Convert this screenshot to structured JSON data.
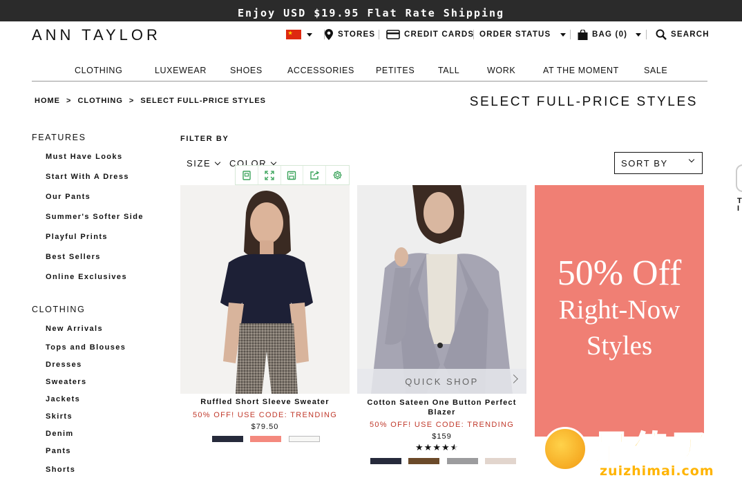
{
  "promo_bar": {
    "text": "Enjoy USD $19.95 Flat Rate Shipping"
  },
  "header": {
    "logo": "ANN TAYLOR",
    "utility": {
      "stores": "STORES",
      "credit_cards": "CREDIT CARDS",
      "order_status": "ORDER STATUS",
      "bag": "BAG (0)",
      "search": "SEARCH"
    }
  },
  "nav": {
    "items": [
      "CLOTHING",
      "LUXEWEAR",
      "SHOES",
      "ACCESSORIES",
      "PETITES",
      "TALL",
      "WORK",
      "AT THE MOMENT",
      "SALE"
    ]
  },
  "breadcrumb": {
    "home": "HOME",
    "sep1": ">",
    "clothing": "CLOTHING",
    "sep2": ">",
    "current": "SELECT FULL-PRICE STYLES"
  },
  "page_title": "SELECT FULL-PRICE STYLES",
  "sidebar": {
    "features_heading": "FEATURES",
    "features": [
      "Must Have Looks",
      "Start With A Dress",
      "Our Pants",
      "Summer's Softer Side",
      "Playful Prints",
      "Best Sellers",
      "Online Exclusives"
    ],
    "clothing_heading": "CLOTHING",
    "clothing": [
      "New Arrivals",
      "Tops and Blouses",
      "Dresses",
      "Sweaters",
      "Jackets",
      "Skirts",
      "Denim",
      "Pants",
      "Shorts"
    ]
  },
  "filters": {
    "filter_by": "FILTER BY",
    "size": "SIZE",
    "color": "COLOR",
    "sort_by": "SORT BY"
  },
  "products": [
    {
      "name": "Ruffled Short Sleeve Sweater",
      "promo": "50% OFF! USE CODE: TRENDING",
      "price": "$79.50",
      "swatches": [
        "#262a3b",
        "#f4897e",
        "#f7f7f5"
      ]
    },
    {
      "name": "Cotton Sateen One Button Perfect Blazer",
      "promo": "50% OFF! USE CODE: TRENDING",
      "price": "$159",
      "rating": 4.5,
      "quick_shop": "QUICK SHOP",
      "swatches": [
        "#262a3b",
        "#6b4a2a",
        "#9c9c9e",
        "#e2d5cd"
      ]
    }
  ],
  "promo_tile": {
    "line1": "50% Off",
    "line2": "Right-Now",
    "line3": "Styles"
  },
  "watermark": {
    "brand": "最值买",
    "url": "zuizhimai.com"
  },
  "edge_text": "T I",
  "colors": {
    "promo_red": "#c0392b",
    "tile_coral": "#f07f74",
    "dark_bar": "#2b2b2b"
  }
}
